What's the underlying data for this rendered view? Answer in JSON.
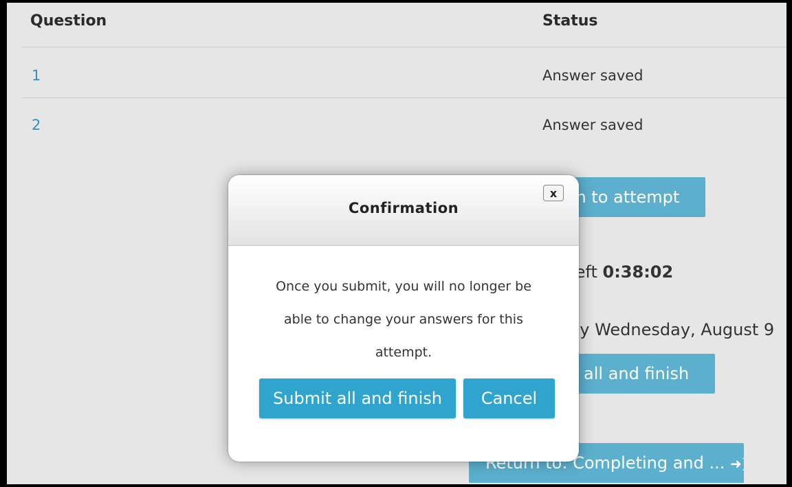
{
  "table": {
    "headers": {
      "question": "Question",
      "status": "Status"
    },
    "rows": [
      {
        "number": "1",
        "status": "Answer saved"
      },
      {
        "number": "2",
        "status": "Answer saved"
      }
    ]
  },
  "background": {
    "return_to_attempt": "rn to attempt",
    "time_left_prefix": "left ",
    "time_left_value": "0:38:02",
    "due_text": "by Wednesday, August 9",
    "submit_all": "t all and finish",
    "return_to_link": "Return to: Completing and ...",
    "return_icon": "sign-in-icon"
  },
  "modal": {
    "title": "Confirmation",
    "close_label": "x",
    "message_lines": [
      "Once you submit, you will no longer be",
      "able to change your answers for this",
      "attempt."
    ],
    "submit_label": "Submit all and finish",
    "cancel_label": "Cancel"
  },
  "colors": {
    "link": "#3a8fb7",
    "button": "#2fa4cf",
    "button_dim": "#5cb0cd"
  }
}
